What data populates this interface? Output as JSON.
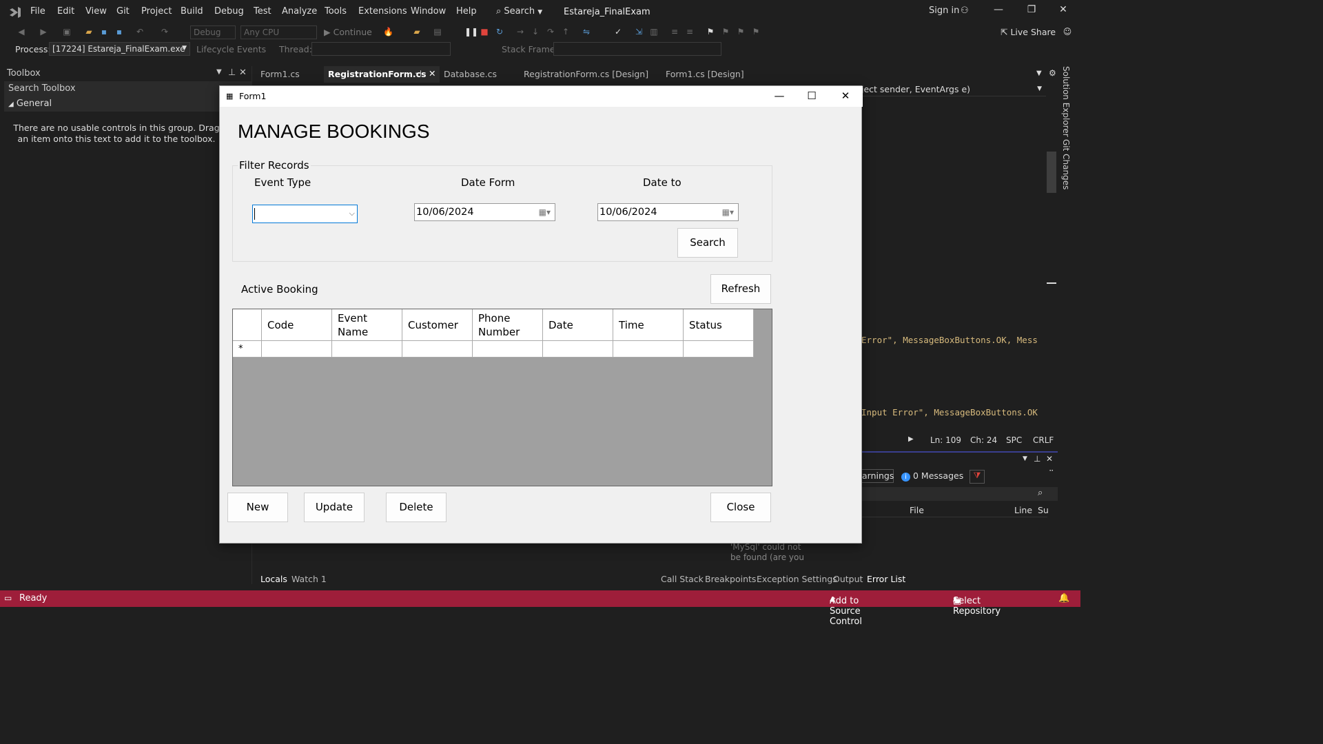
{
  "titlebar": {
    "menu": [
      "File",
      "Edit",
      "View",
      "Git",
      "Project",
      "Build",
      "Debug",
      "Test",
      "Analyze",
      "Tools",
      "Extensions",
      "Window",
      "Help"
    ],
    "search_label": "Search",
    "solution_name": "Estareja_FinalExam",
    "sign_in": "Sign in"
  },
  "toolbar": {
    "config": "Debug",
    "platform": "Any CPU",
    "continue_label": "Continue",
    "live_share": "Live Share",
    "process_label": "Process:",
    "process_value": "[17224] Estareja_FinalExam.exe",
    "lifecycle_label": "Lifecycle Events",
    "thread_label": "Thread:",
    "stack_frame_label": "Stack Frame:"
  },
  "toolbox": {
    "title": "Toolbox",
    "search_placeholder": "Search Toolbox",
    "group": "General",
    "message": "There are no usable controls in this group. Drag an item onto this text to add it to the toolbox."
  },
  "doc_tabs": [
    {
      "label": "Form1.cs",
      "active": false
    },
    {
      "label": "RegistrationForm.cs",
      "active": true
    },
    {
      "label": "Database.cs",
      "active": false
    },
    {
      "label": "RegistrationForm.cs [Design]",
      "active": false
    },
    {
      "label": "Form1.cs [Design]",
      "active": false
    }
  ],
  "editor": {
    "member_dropdown": "ject sender, EventArgs e)",
    "code_line_1": "Error\", MessageBoxButtons.OK, Mess",
    "code_line_2": "Input Error\", MessageBoxButtons.OK",
    "status_ln": "Ln: 109",
    "status_ch": "Ch: 24",
    "status_spc": "SPC",
    "status_crlf": "CRLF"
  },
  "side_tabs": [
    "Solution Explorer",
    "Git Changes"
  ],
  "error_list": {
    "warnings_label": "arnings",
    "messages_label": "0 Messages",
    "col_file": "File",
    "col_line": "Line",
    "col_s": "Su",
    "entry_text": "'MySql' could not be found (are you"
  },
  "bottom_tabs_left": [
    "Locals",
    "Watch 1"
  ],
  "bottom_tabs_right": [
    "Call Stack",
    "Breakpoints",
    "Exception Settings",
    "Output",
    "Error List"
  ],
  "statusbar": {
    "ready": "Ready",
    "add_source": "Add to Source Control",
    "select_repo": "Select Repository"
  },
  "dialog": {
    "title": "Form1",
    "heading": "MANAGE BOOKINGS",
    "filter_group": "Filter Records",
    "event_type_label": "Event Type",
    "date_from_label": "Date Form",
    "date_to_label": "Date to",
    "event_type_value": "",
    "date_from_value": "10/06/2024",
    "date_to_value": "10/06/2024",
    "search_button": "Search",
    "active_booking_label": "Active Booking",
    "refresh_button": "Refresh",
    "grid_columns": [
      "Code",
      "Event Name",
      "Customer",
      "Phone Number",
      "Date",
      "Time",
      "Status"
    ],
    "new_row_marker": "*",
    "new_button": "New",
    "update_button": "Update",
    "delete_button": "Delete",
    "close_button": "Close"
  }
}
